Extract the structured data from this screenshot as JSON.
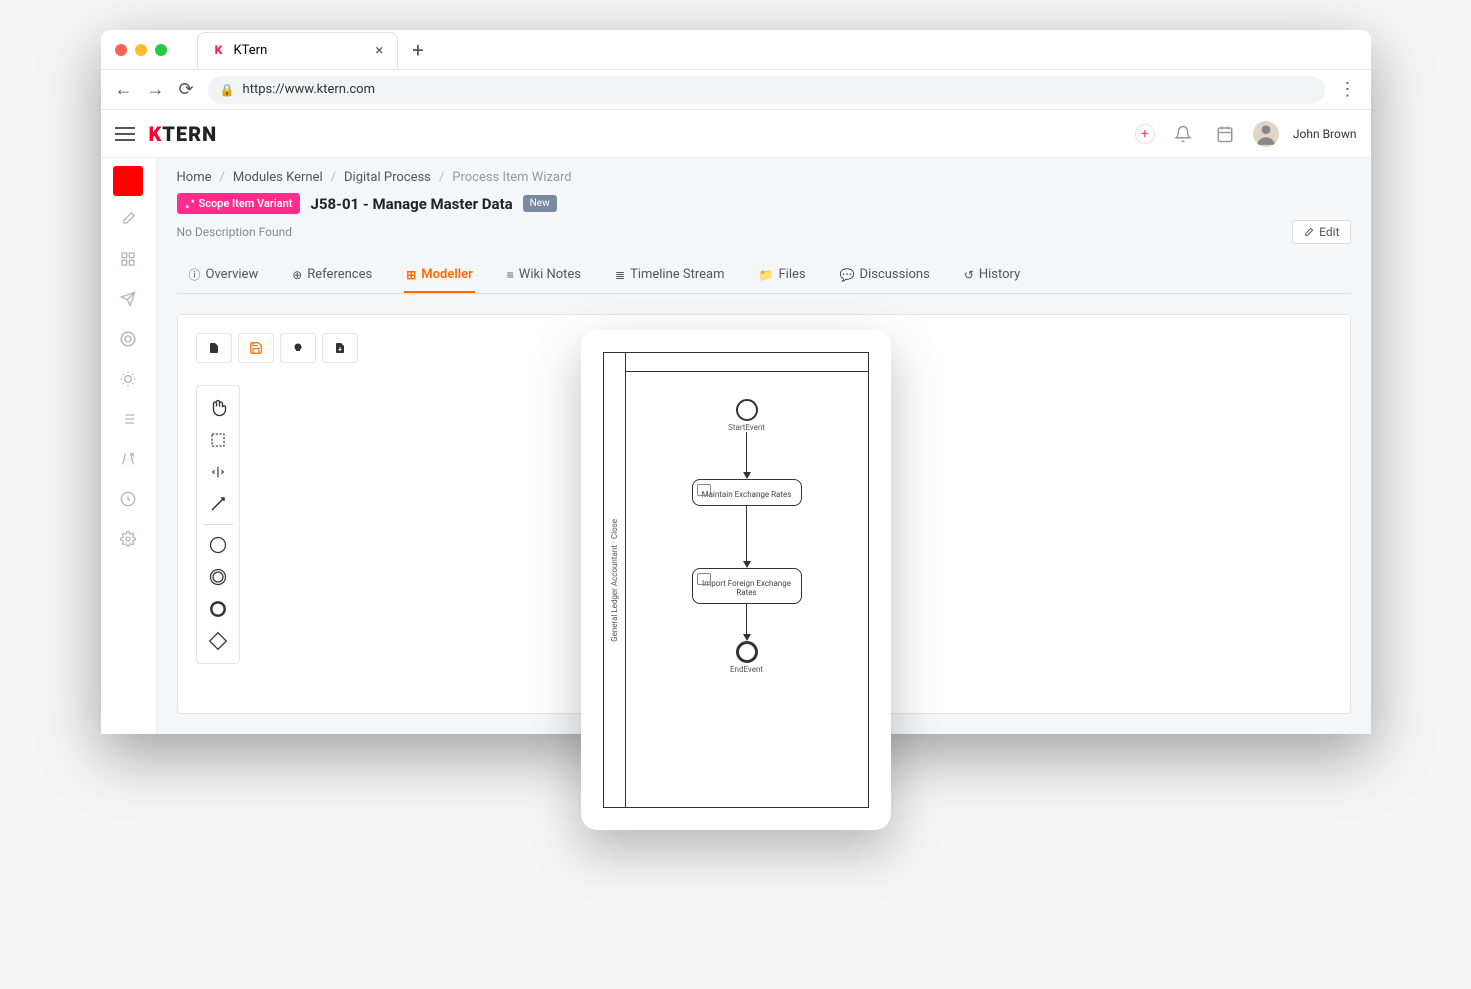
{
  "browser": {
    "tab_title": "KTern",
    "url": "https://www.ktern.com"
  },
  "appbar": {
    "logo_text_prefix": "K",
    "logo_text_rest": "TERN",
    "username": "John Brown"
  },
  "breadcrumb": {
    "items": [
      "Home",
      "Modules Kernel",
      "Digital Process",
      "Process Item Wizard"
    ]
  },
  "header": {
    "variant_badge": "Scope Item Variant",
    "title": "J58-01 - Manage Master Data",
    "new_badge": "New",
    "description": "No Description Found",
    "edit_label": "Edit"
  },
  "tabs": [
    {
      "icon": "ⓘ",
      "label": "Overview"
    },
    {
      "icon": "⊕",
      "label": "References"
    },
    {
      "icon": "⊞",
      "label": "Modeller",
      "active": true
    },
    {
      "icon": "≡",
      "label": "Wiki Notes"
    },
    {
      "icon": "≣",
      "label": "Timeline Stream"
    },
    {
      "icon": "📁",
      "label": "Files"
    },
    {
      "icon": "💬",
      "label": "Discussions"
    },
    {
      "icon": "↺",
      "label": "History"
    }
  ],
  "bpmn": {
    "lane_title": "General Ledger Accountant · Close",
    "start_label": "StartEvent",
    "task1": "Maintain Exchange Rates",
    "task2": "Import Foreign Exchange Rates",
    "end_label": "EndEvent"
  }
}
